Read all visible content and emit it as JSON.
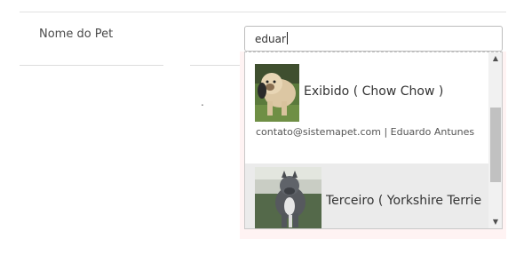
{
  "form": {
    "pet_name_label": "Nome do Pet",
    "pet_name_value": "eduar",
    "dot": "."
  },
  "autocomplete": {
    "items": [
      {
        "name": "Exibido ( Chow Chow )",
        "owner": "contato@sistemapet.com | Eduardo Antunes",
        "photo": "chow-chow-dog-photo"
      },
      {
        "name": "Terceiro ( Yorkshire Terrie",
        "photo": "pit-bull-dog-photo"
      }
    ],
    "highlighted_index": 1
  },
  "icons": {
    "scroll_up": "▲",
    "scroll_down": "▼"
  },
  "colors": {
    "highlight_row": "#ebebeb",
    "input_border": "#bdbdbd",
    "scroll_thumb": "#c1c1c1"
  }
}
